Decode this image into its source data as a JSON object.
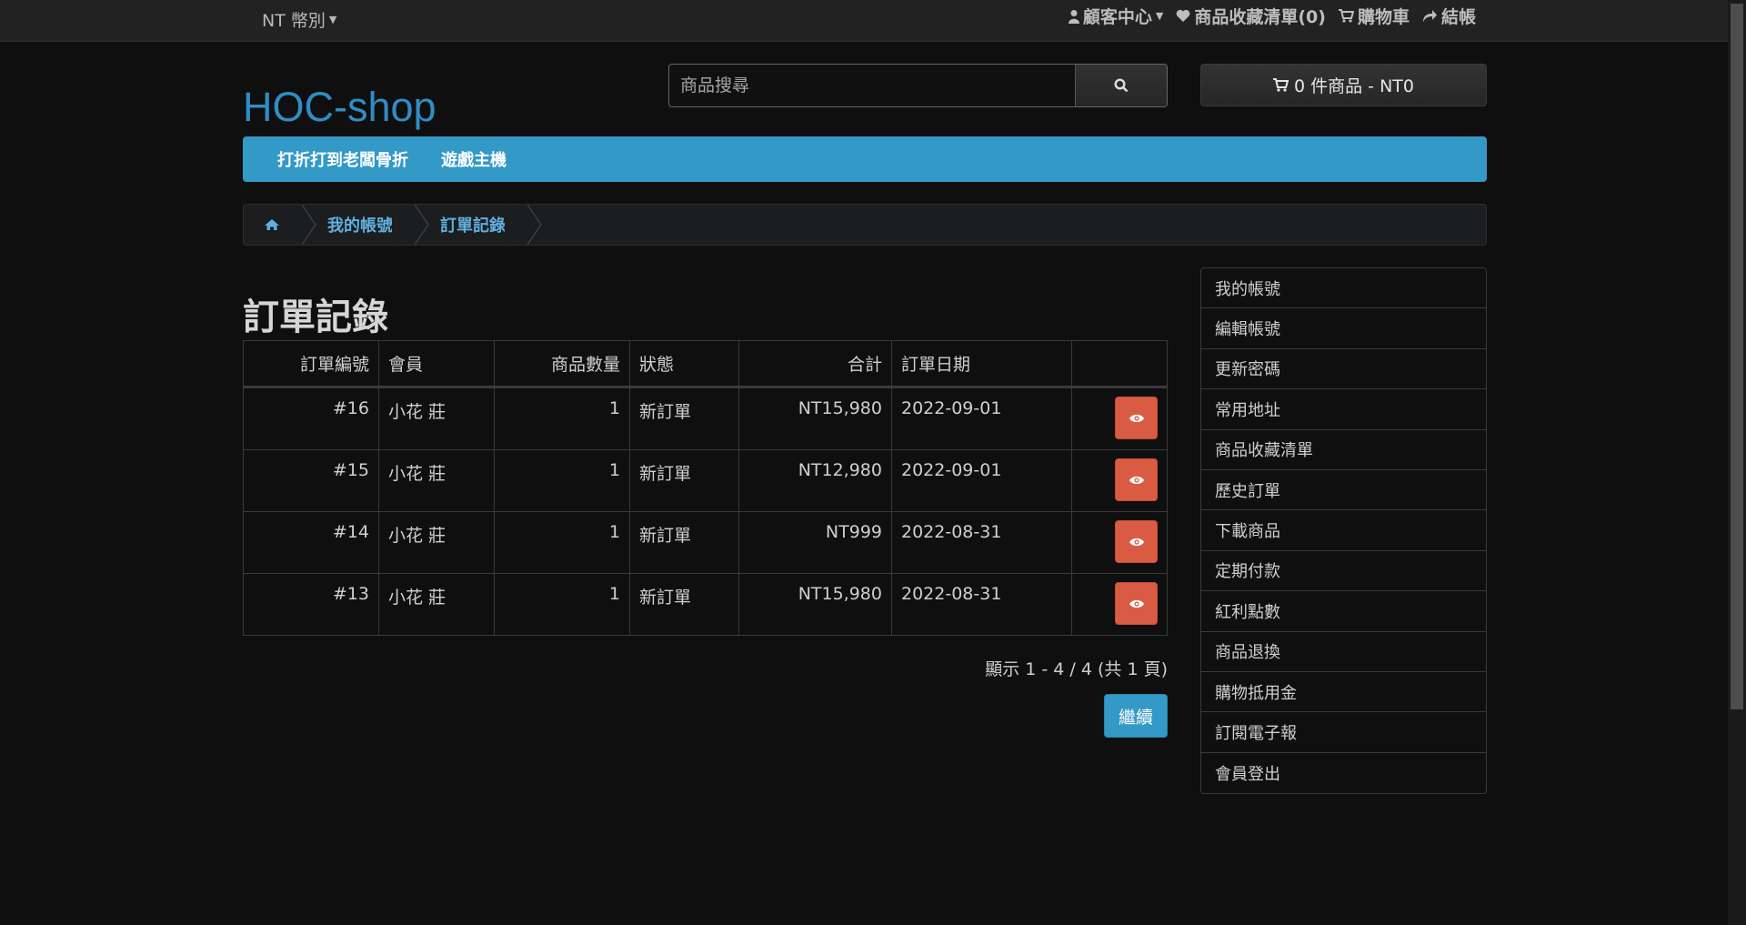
{
  "topbar": {
    "currency": "NT 幣別",
    "links": [
      {
        "icon": "user-icon",
        "label": "顧客中心",
        "caret": true
      },
      {
        "icon": "heart-icon",
        "label": "商品收藏清單(0)"
      },
      {
        "icon": "cart-icon",
        "label": "購物車"
      },
      {
        "icon": "share-icon",
        "label": "結帳"
      }
    ]
  },
  "logo": "HOC-shop",
  "search": {
    "placeholder": "商品搜尋"
  },
  "cart": {
    "label": "0 件商品 - NT0"
  },
  "nav": [
    "打折打到老闆骨折",
    "遊戲主機"
  ],
  "breadcrumb": [
    "我的帳號",
    "訂單記錄"
  ],
  "page_title": "訂單記錄",
  "table": {
    "headers": [
      "訂單編號",
      "會員",
      "商品數量",
      "狀態",
      "合計",
      "訂單日期",
      ""
    ],
    "rows": [
      {
        "id": "#16",
        "member": "小花 莊",
        "qty": "1",
        "status": "新訂單",
        "total": "NT15,980",
        "date": "2022-09-01"
      },
      {
        "id": "#15",
        "member": "小花 莊",
        "qty": "1",
        "status": "新訂單",
        "total": "NT12,980",
        "date": "2022-09-01"
      },
      {
        "id": "#14",
        "member": "小花 莊",
        "qty": "1",
        "status": "新訂單",
        "total": "NT999",
        "date": "2022-08-31"
      },
      {
        "id": "#13",
        "member": "小花 莊",
        "qty": "1",
        "status": "新訂單",
        "total": "NT15,980",
        "date": "2022-08-31"
      }
    ]
  },
  "pagination": "顯示 1 - 4 / 4 (共 1 頁)",
  "continue_label": "繼續",
  "sidebar": [
    "我的帳號",
    "編輯帳號",
    "更新密碼",
    "常用地址",
    "商品收藏清單",
    "歷史訂單",
    "下載商品",
    "定期付款",
    "紅利點數",
    "商品退換",
    "購物抵用金",
    "訂閱電子報",
    "會員登出"
  ],
  "colors": {
    "accent": "#3399c7",
    "danger": "#da5b44",
    "background": "#0f0f0f"
  }
}
